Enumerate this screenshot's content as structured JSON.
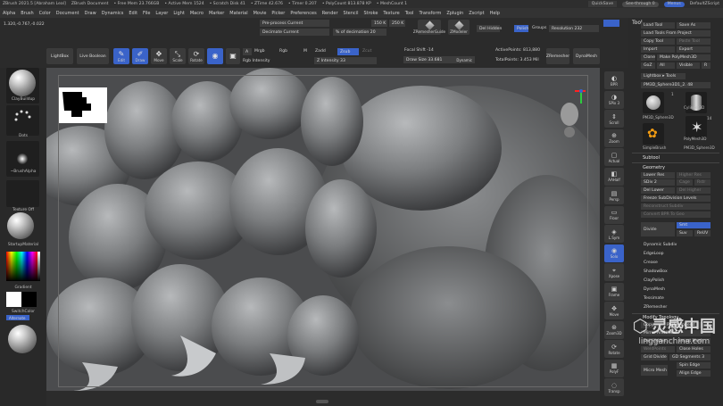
{
  "titlebar": {
    "app": "ZBrush 2021.5 [Abraham Leal]",
    "doc": "ZBrush Document",
    "stats": [
      "• Free Mem 23.766GB",
      "• Active Mem 1524",
      "• Scratch Disk 41",
      "• ZTime 42.676",
      "• Timer 0.207",
      "• PolyCount 813.878 KP",
      "• MeshCount 1"
    ],
    "quicksave": "QuickSave",
    "seethrough": "See-through 0",
    "menus_label": "Menus",
    "script": "DefaultZScript"
  },
  "menubar": [
    "Alpha",
    "Brush",
    "Color",
    "Document",
    "Draw",
    "Dynamics",
    "Edit",
    "File",
    "Layer",
    "Light",
    "Macro",
    "Marker",
    "Material",
    "Movie",
    "Picker",
    "Preferences",
    "Render",
    "Stencil",
    "Stroke",
    "Texture",
    "Tool",
    "Transform",
    "Zplugin",
    "Zscript",
    "Help"
  ],
  "coords": "1.320,-0.767,-0.022",
  "shelf": {
    "lightbox": "LightBox",
    "live_boolean": "Live Boolean",
    "edit": "Edit",
    "draw": "Draw",
    "move": "Move",
    "scale": "Scale",
    "rotate": "Rotate",
    "mrgb": "Mrgb",
    "rgb": "Rgb",
    "m": "M",
    "zadd": "Zadd",
    "zsub": "Zsub",
    "zcut": "Zcut",
    "rgb_intensity": "Rgb Intensity",
    "z_intensity": "Z Intensity 33",
    "preprocess": "Pre-process Current",
    "decimate": "Decimate Current",
    "pct_decimation": "% of decimation 20",
    "val_150k": "150 K",
    "val_250k": "250 K",
    "zremesher_guide": "ZRemesherGuide",
    "zmodeler": "ZModeler",
    "del_hidden": "Del Hidden",
    "polish": "Polish",
    "groups": "Groups",
    "resolution": "Resolution 232",
    "focal_shift": "Focal Shift -14",
    "draw_size": "Draw Size 33.681",
    "dynamic": "Dynamic",
    "active_points": "ActivePoints: 813,880",
    "total_points": "TotalPoints: 3.453 Mil",
    "zremesher": "ZRemesher",
    "dynamesh": "DynaMesh"
  },
  "lefttray": {
    "brush": "ClayBuildup",
    "stroke": "Dots",
    "alpha": "~BrushAlpha",
    "texture": "Texture Off",
    "material": "StartupMaterial",
    "gradient": "Gradient",
    "switch_color": "SwitchColor",
    "alternate": "Alternate"
  },
  "righttool": [
    "BPR",
    "SPix 3",
    "Scroll",
    "Zoom",
    "Actual",
    "AAHalf",
    "Persp",
    "Floor",
    "L.Sym",
    "Solo",
    "Xpose",
    "Frame",
    "Move",
    "Zoom3D",
    "Rotate",
    "PolyF",
    "Transp"
  ],
  "palette": {
    "title": "Tool",
    "load_tool": "Load Tool",
    "save_as": "Save As",
    "load_from_project": "Load Tools From Project",
    "copy_tool": "Copy Tool",
    "paste_tool": "Paste Tool",
    "import": "Import",
    "export": "Export",
    "clone": "Clone",
    "make_polymesh": "Make PolyMesh3D",
    "goz": "GoZ",
    "all": "All",
    "visible": "Visible",
    "r": "R",
    "lightbox_tools": "Lightbox ▸ Tools",
    "current_tool": "PM3D_Sphere3D1_2. 48",
    "tile_names": [
      "PM3D_Sphere3D",
      "Cylinder3D",
      "PolyMesh3D",
      "SimpleBrush",
      "PM3D_Sphere3D"
    ],
    "tile_counts": [
      "1",
      "14"
    ],
    "subtool": "Subtool",
    "geometry": "Geometry",
    "lower_res": "Lower Res",
    "higher_res": "Higher Res",
    "sdiv": "SDiv 2",
    "cage": "Cage",
    "rstr": "Rstr",
    "del_lower": "Del Lower",
    "del_higher": "Del Higher",
    "freeze": "Freeze SubDivision Levels",
    "reconstruct": "Reconstruct Subdiv",
    "convert_bpr": "Convert BPR To Geo",
    "divide": "Divide",
    "smt": "Smt",
    "suv": "Suv",
    "reuv": "ReUV",
    "items": [
      "Dynamic Subdiv",
      "EdgeLoop",
      "Crease",
      "ShadowBox",
      "ClayPolish",
      "DynaMesh",
      "Tessimate",
      "ZRemesher"
    ],
    "modify_topology": "Modify Topology",
    "copy": "Copy",
    "paste_append": "Paste Append",
    "mirror_weld": "Mirror And Weld",
    "del_hidden": "Del Hidden",
    "insert_mesh": "Insert Mesh",
    "weld_points": "WeldPoints",
    "close_holes": "Close Holes",
    "grid_divide": "Grid Divide",
    "gd_segments": "GD Segments 3",
    "micro_mesh": "Micro Mesh",
    "spin_edge": "Spin Edge",
    "align_edge": "Align Edge"
  },
  "watermark": {
    "cn": "灵感中国",
    "url": "lingganchina.com"
  },
  "colors": {
    "accent_blue": "#3a63c9",
    "panel": "#2a2a2a",
    "viewport": "#4f5052"
  }
}
